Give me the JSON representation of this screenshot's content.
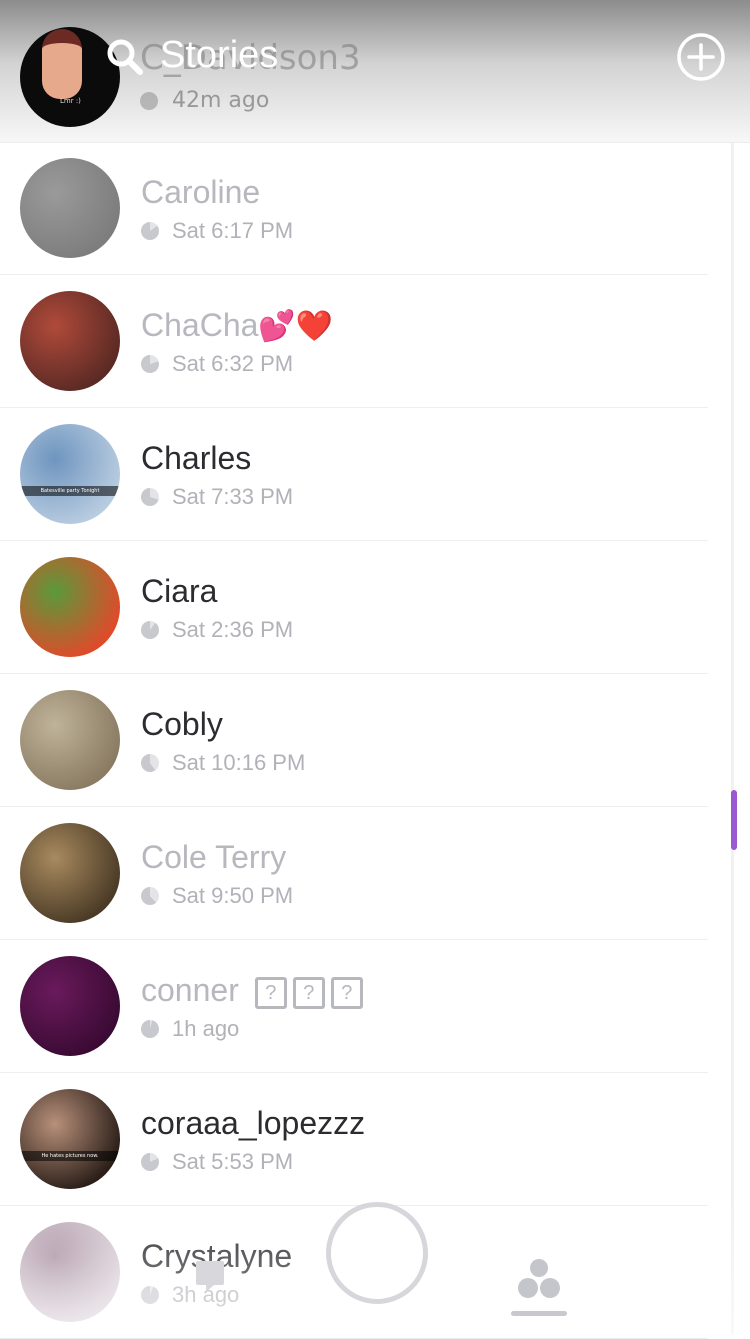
{
  "header": {
    "title": "Stories",
    "partial_row": {
      "name": "C_Davidson3",
      "time": "42m ago"
    }
  },
  "stories": [
    {
      "name": "Caroline",
      "time": "Sat 6:17 PM",
      "viewed": true,
      "clock_used": 15,
      "avatar_colors": [
        "#7d7d7d",
        "#9a9a9a"
      ]
    },
    {
      "name": "ChaCha",
      "emoji": "💕❤️",
      "time": "Sat 6:32 PM",
      "viewed": true,
      "clock_used": 20,
      "avatar_colors": [
        "#5a2a24",
        "#b04a3a"
      ]
    },
    {
      "name": "Charles",
      "time": "Sat 7:33 PM",
      "viewed": false,
      "clock_used": 30,
      "avatar_colors": [
        "#b8cce0",
        "#6f95bf"
      ],
      "avatar_caption": "Batesville party Tonight"
    },
    {
      "name": "Ciara",
      "time": "Sat 2:36 PM",
      "viewed": false,
      "clock_used": 10,
      "avatar_colors": [
        "#e04a2a",
        "#5a9a3a"
      ]
    },
    {
      "name": "Cobly",
      "time": "Sat 10:16 PM",
      "viewed": false,
      "clock_used": 40,
      "avatar_colors": [
        "#8a7b62",
        "#bfb39a"
      ]
    },
    {
      "name": "Cole Terry",
      "time": "Sat 9:50 PM",
      "viewed": true,
      "clock_used": 38,
      "avatar_colors": [
        "#4a3a26",
        "#a88a5e"
      ]
    },
    {
      "name": "conner",
      "boxes": [
        "?",
        "?",
        "?"
      ],
      "time": "1h ago",
      "viewed": true,
      "clock_used": 4,
      "avatar_colors": [
        "#3a0a33",
        "#6a1a5c"
      ]
    },
    {
      "name": "coraaa_lopezzz",
      "time": "Sat 5:53 PM",
      "viewed": false,
      "clock_used": 18,
      "avatar_colors": [
        "#2a1e18",
        "#b8907a"
      ],
      "avatar_caption": "He hates pictures now."
    },
    {
      "name": "Crystalyne",
      "time": "3h ago",
      "viewed": false,
      "clock_used": 6,
      "avatar_colors": [
        "#d9cfd6",
        "#a990a2"
      ]
    }
  ],
  "icons": {
    "search": "search-icon",
    "add": "add-icon",
    "chat": "chat-icon",
    "capture": "capture-button",
    "stories": "stories-icon"
  },
  "colors": {
    "accent_scroll": "#9b59d0",
    "unviewed_text": "#2b2b30",
    "viewed_text": "#b7b7be"
  }
}
